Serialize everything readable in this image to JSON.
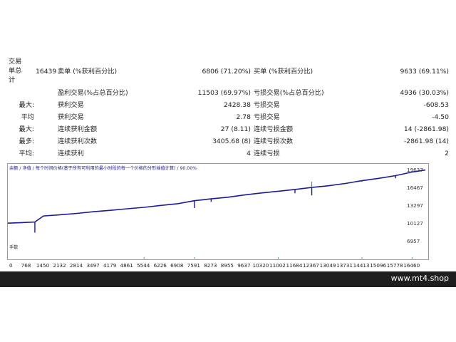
{
  "stats": {
    "total_trades_label": "交易\n单总\n计",
    "total_trades_value": "16439",
    "short_label": "卖单 (%获利百分比)",
    "short_value": "6806 (71.20%)",
    "long_label": "买单 (%获利百分比)",
    "long_value": "9633 (69.11%)",
    "profit_trades_label": "盈利交易(%占总百分比)",
    "profit_trades_value": "11503 (69.97%)",
    "loss_trades_label": "亏损交易(%占总百分比)",
    "loss_trades_value": "4936 (30.03%)",
    "rows": [
      {
        "pre": "最大:",
        "l1": "获利交易",
        "v1": "2428.38",
        "l2": "亏损交易",
        "v2": "-608.53"
      },
      {
        "pre": "平均",
        "l1": "获利交易",
        "v1": "2.78",
        "l2": "亏损交易",
        "v2": "-4.50"
      },
      {
        "pre": "最大:",
        "l1": "连续获利金额",
        "v1": "27 (8.11)",
        "l2": "连续亏损金额",
        "v2": "14 (-2861.98)"
      },
      {
        "pre": "最多:",
        "l1": "连续获利次数",
        "v1": "3405.68 (8)",
        "l2": "连续亏损次数",
        "v2": "-2861.98 (14)"
      },
      {
        "pre": "平均:",
        "l1": "连续获利",
        "v1": "4",
        "l2": "连续亏损",
        "v2": "2"
      }
    ]
  },
  "chart_data": {
    "type": "line",
    "legend_text": "余额 / 净值 / 每个时间价格(基于所有可利用的最小时段的每一个价格的分形插值计算) / 90.00%",
    "subpanel_label": "手数",
    "x_ticks": [
      "0",
      "768",
      "1450",
      "2132",
      "2814",
      "3497",
      "4179",
      "4861",
      "5544",
      "6226",
      "6908",
      "7591",
      "8273",
      "8955",
      "9637",
      "10320",
      "11002",
      "11684",
      "12367",
      "13049",
      "13731",
      "14413",
      "15096",
      "15778",
      "16460"
    ],
    "y_ticks": [
      "19637",
      "16467",
      "13297",
      "10127",
      "6957"
    ],
    "ylim": [
      6957,
      19637
    ],
    "xlim": [
      0,
      16990
    ],
    "series": [
      {
        "name": "余额",
        "color": "#1a1a9a",
        "x": [
          0,
          500,
          1100,
          1450,
          2132,
          2814,
          3497,
          4179,
          4861,
          5544,
          6226,
          6908,
          7591,
          8273,
          8955,
          9637,
          10320,
          11002,
          11684,
          12367,
          13049,
          13731,
          14413,
          15096,
          15778,
          16460,
          16990
        ],
        "y": [
          10100,
          10180,
          10300,
          11380,
          11600,
          11840,
          12140,
          12380,
          12660,
          12920,
          13260,
          13560,
          14100,
          14420,
          14720,
          15120,
          15480,
          15780,
          16100,
          16460,
          16760,
          17160,
          17660,
          18080,
          18560,
          19200,
          19560
        ]
      }
    ],
    "drops": [
      {
        "x": 1100,
        "y": 8420
      },
      {
        "x": 7591,
        "y": 12800
      },
      {
        "x": 8273,
        "y": 13900
      },
      {
        "x": 11684,
        "y": 15420
      },
      {
        "x": 12367,
        "y": 15050
      },
      {
        "x": 14413,
        "y": 17500
      },
      {
        "x": 15778,
        "y": 18100
      }
    ],
    "spikes": [
      {
        "x": 12367,
        "y": 17480
      }
    ]
  },
  "footer": {
    "site": "www.mt4.shop"
  },
  "colors": {
    "balance": "#1a1a9a",
    "equity_spike": "#3aa63a",
    "axis": "#9a9a9a",
    "footer_bg": "#1f1f1f"
  }
}
